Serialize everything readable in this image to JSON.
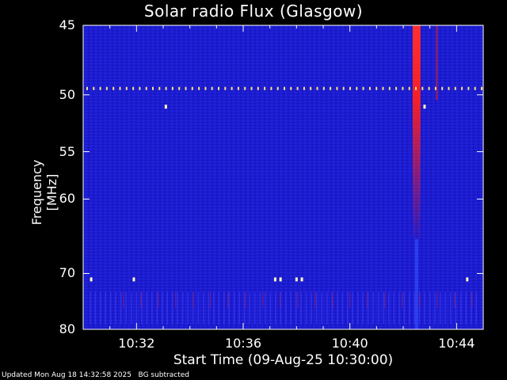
{
  "chart_data": {
    "type": "heatmap",
    "title": "Solar radio Flux (Glasgow)",
    "xlabel": "Start Time (09-Aug-25 10:30:00)",
    "ylabel": "Frequency [MHz]",
    "x_ticks": [
      "10:32",
      "10:36",
      "10:40",
      "10:44"
    ],
    "x_tick_minutes": [
      32,
      36,
      40,
      44
    ],
    "xlim_minutes": [
      30,
      45
    ],
    "y_ticks": [
      45,
      50,
      55,
      60,
      70,
      80
    ],
    "ylim": [
      45,
      80
    ],
    "y_scale": "log-like (inverted, low frequency at top)",
    "colors": {
      "background": "#1a1ad6",
      "burst": "#ff2020",
      "interference": "#ffe080"
    },
    "features": {
      "radio_burst_minute": 42.5,
      "burst_frequency_range": [
        45,
        65
      ],
      "interference_line_frequency": 49.5
    }
  },
  "footer": {
    "updated": "Updated Mon Aug 18 14:32:58 2025",
    "note": "BG subtracted"
  }
}
